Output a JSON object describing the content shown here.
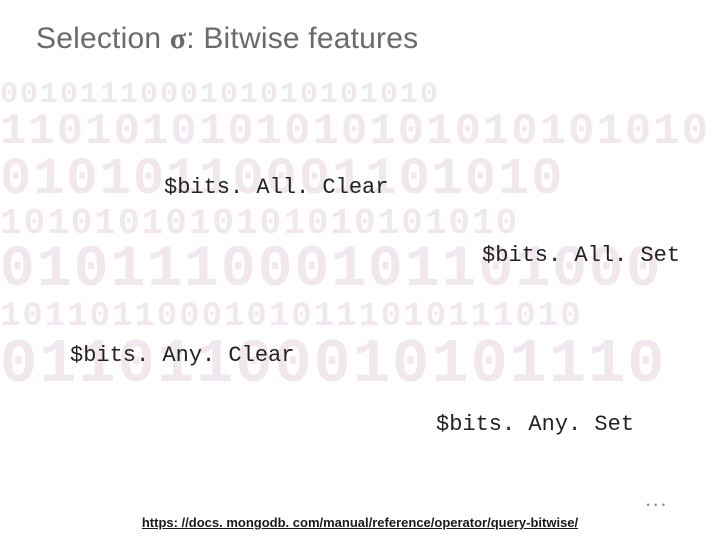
{
  "title": {
    "prefix": "Selection ",
    "sigma": "σ",
    "suffix": ": Bitwise features"
  },
  "operators": {
    "allClear": "$bits. All. Clear",
    "allSet": "$bits. All. Set",
    "anyClear": "$bits. Any. Clear",
    "anySet": "$bits. Any. Set"
  },
  "footer": {
    "link_text": "https: //docs. mongodb. com/manual/reference/operator/query-bitwise/",
    "link_href": "https://docs.mongodb.com/manual/reference/operator/query-bitwise/"
  },
  "decor": {
    "dots": "• • •"
  },
  "bg_rows": [
    {
      "size": 30,
      "text": "0010111000101010101010"
    },
    {
      "size": 44,
      "text": "1101010101010101010101010"
    },
    {
      "size": 52,
      "text": "01010110001101010"
    },
    {
      "size": 36,
      "text": "1010101010101010101010"
    },
    {
      "size": 58,
      "text": "010111000101101000"
    },
    {
      "size": 34,
      "text": "10110110001010111010111010"
    },
    {
      "size": 62,
      "text": "01101100010101110"
    }
  ]
}
